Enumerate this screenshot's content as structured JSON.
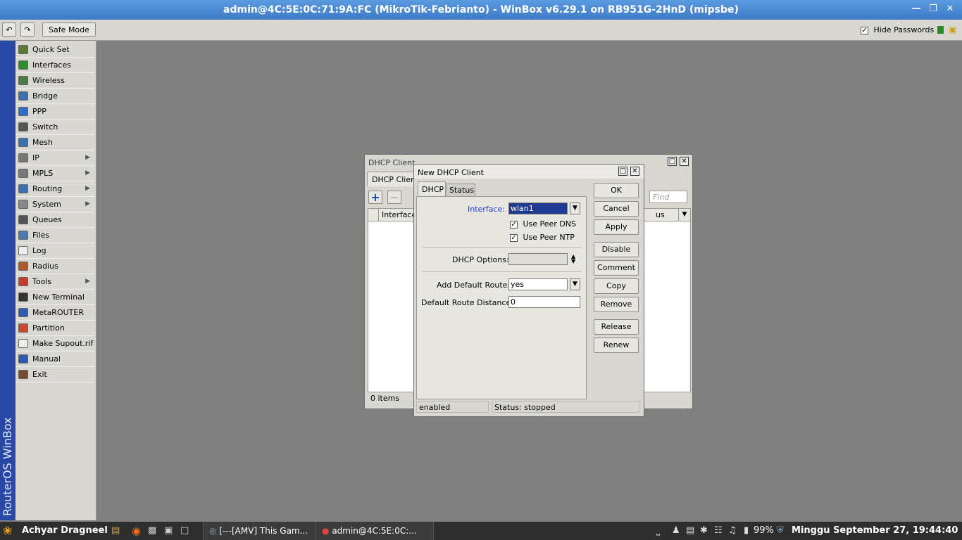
{
  "window": {
    "title": "admin@4C:5E:0C:71:9A:FC (MikroTik-Febrianto) - WinBox v6.29.1 on RB951G-2HnD (mipsbe)"
  },
  "toolbar": {
    "undo_icon": "undo-icon",
    "redo_icon": "redo-icon",
    "safe_mode_label": "Safe Mode",
    "hide_passwords_label": "Hide Passwords",
    "hide_passwords_checked": true
  },
  "sidebar": {
    "brand": "RouterOS WinBox",
    "items": [
      {
        "label": "Quick Set",
        "icon": "quick-set-icon",
        "submenu": false,
        "color": "#5a7a3a"
      },
      {
        "label": "Interfaces",
        "icon": "interfaces-icon",
        "submenu": false,
        "color": "#2e8b2e"
      },
      {
        "label": "Wireless",
        "icon": "wireless-icon",
        "submenu": false,
        "color": "#4a7a4a"
      },
      {
        "label": "Bridge",
        "icon": "bridge-icon",
        "submenu": false,
        "color": "#3a6fb0"
      },
      {
        "label": "PPP",
        "icon": "ppp-icon",
        "submenu": false,
        "color": "#2e6ec8"
      },
      {
        "label": "Switch",
        "icon": "switch-icon",
        "submenu": false,
        "color": "#555555"
      },
      {
        "label": "Mesh",
        "icon": "mesh-icon",
        "submenu": false,
        "color": "#3a6fb0"
      },
      {
        "label": "IP",
        "icon": "ip-icon",
        "submenu": true,
        "color": "#777777"
      },
      {
        "label": "MPLS",
        "icon": "mpls-icon",
        "submenu": true,
        "color": "#777777"
      },
      {
        "label": "Routing",
        "icon": "routing-icon",
        "submenu": true,
        "color": "#3a6fb0"
      },
      {
        "label": "System",
        "icon": "system-icon",
        "submenu": true,
        "color": "#888888"
      },
      {
        "label": "Queues",
        "icon": "queues-icon",
        "submenu": false,
        "color": "#555555"
      },
      {
        "label": "Files",
        "icon": "files-icon",
        "submenu": false,
        "color": "#4a7ab0"
      },
      {
        "label": "Log",
        "icon": "log-icon",
        "submenu": false,
        "color": "#eeeeee"
      },
      {
        "label": "Radius",
        "icon": "radius-icon",
        "submenu": false,
        "color": "#b05a2e"
      },
      {
        "label": "Tools",
        "icon": "tools-icon",
        "submenu": true,
        "color": "#c83a2e"
      },
      {
        "label": "New Terminal",
        "icon": "terminal-icon",
        "submenu": false,
        "color": "#333333"
      },
      {
        "label": "MetaROUTER",
        "icon": "metarouter-icon",
        "submenu": false,
        "color": "#2e5ab0"
      },
      {
        "label": "Partition",
        "icon": "partition-icon",
        "submenu": false,
        "color": "#c84a2e"
      },
      {
        "label": "Make Supout.rif",
        "icon": "supout-icon",
        "submenu": false,
        "color": "#eeeeee"
      },
      {
        "label": "Manual",
        "icon": "manual-icon",
        "submenu": false,
        "color": "#2e5ab0"
      },
      {
        "label": "Exit",
        "icon": "exit-icon",
        "submenu": false,
        "color": "#7a4a2e"
      }
    ]
  },
  "dhcp_list": {
    "title": "DHCP Client",
    "tab": "DHCP Client",
    "find_placeholder": "Find",
    "col_interface": "Interface",
    "col_status": "us",
    "items_count": "0 items"
  },
  "dialog": {
    "title": "New DHCP Client",
    "tabs": [
      "DHCP",
      "Status"
    ],
    "interface_label": "Interface:",
    "interface_value": "wlan1",
    "use_peer_dns_label": "Use Peer DNS",
    "use_peer_dns": true,
    "use_peer_ntp_label": "Use Peer NTP",
    "use_peer_ntp": true,
    "dhcp_options_label": "DHCP Options:",
    "dhcp_options_value": "",
    "add_default_route_label": "Add Default Route:",
    "add_default_route_value": "yes",
    "default_route_distance_label": "Default Route Distance:",
    "default_route_distance_value": "0",
    "buttons": [
      "OK",
      "Cancel",
      "Apply",
      "Disable",
      "Comment",
      "Copy",
      "Remove",
      "Release",
      "Renew"
    ],
    "status_left": "enabled",
    "status_right": "Status: stopped"
  },
  "taskbar": {
    "user": "Achyar Dragneel",
    "task1": "[---[AMV] This Gam...",
    "task2": "admin@4C:5E:0C:...",
    "battery": "99%",
    "datetime": "Minggu September 27, 19:44:40"
  }
}
